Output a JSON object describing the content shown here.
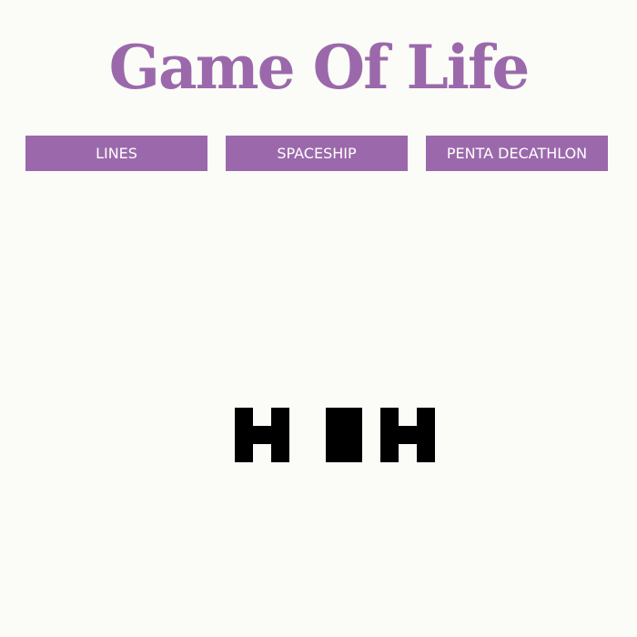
{
  "title": "Game Of Life",
  "buttons": {
    "lines": "LINES",
    "spaceship": "SPACESHIP",
    "penta_decathlon": "PENTA DECATHLON"
  },
  "colors": {
    "accent": "#9b69ab",
    "background": "#fbfcf7",
    "live_cell": "#000000"
  },
  "board": {
    "live_cells": [
      [
        13,
        13
      ],
      [
        13,
        14
      ],
      [
        13,
        15
      ],
      [
        14,
        14
      ],
      [
        15,
        13
      ],
      [
        15,
        14
      ],
      [
        15,
        15
      ],
      [
        18,
        13
      ],
      [
        18,
        14
      ],
      [
        18,
        15
      ],
      [
        19,
        13
      ],
      [
        19,
        14
      ],
      [
        19,
        15
      ],
      [
        21,
        13
      ],
      [
        21,
        14
      ],
      [
        21,
        15
      ],
      [
        22,
        14
      ],
      [
        23,
        13
      ],
      [
        23,
        14
      ],
      [
        23,
        15
      ]
    ]
  }
}
